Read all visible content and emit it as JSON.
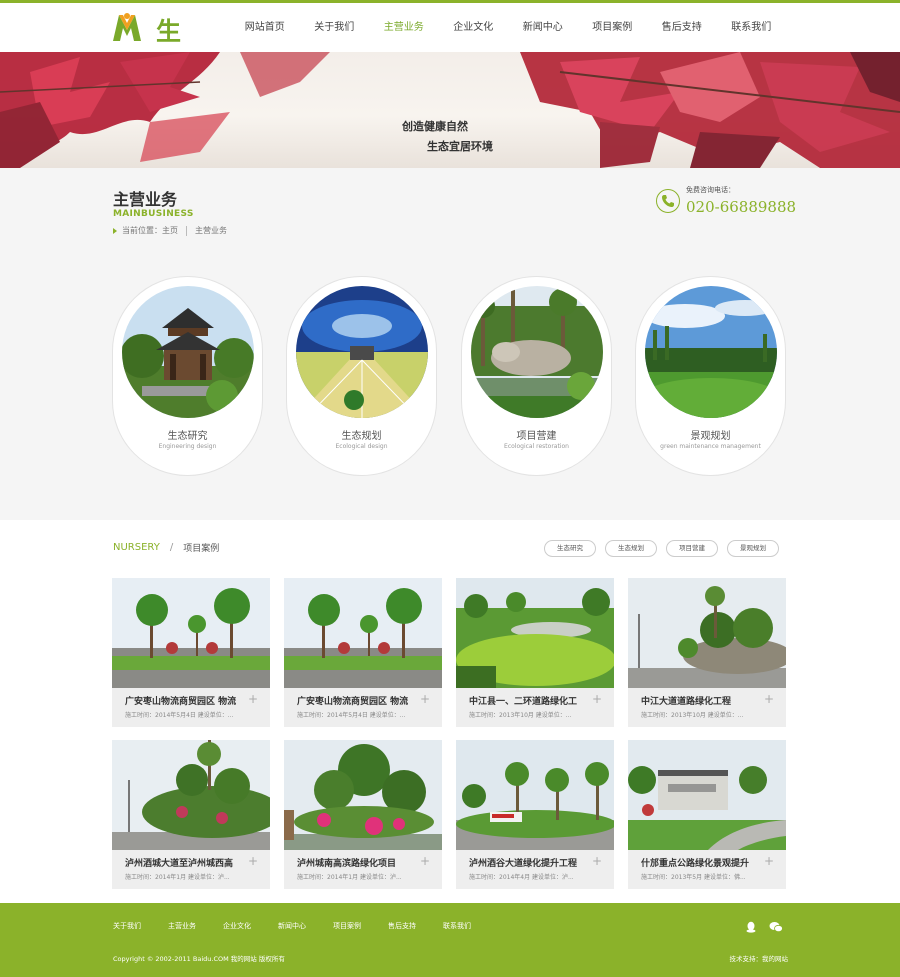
{
  "colors": {
    "brand": "#8bb22a",
    "footer": "#8bb22a",
    "pageBg": "#f5f5f5"
  },
  "header": {
    "logo_text": "生态",
    "nav": [
      {
        "label": "网站首页"
      },
      {
        "label": "关于我们"
      },
      {
        "label": "主营业务"
      },
      {
        "label": "企业文化"
      },
      {
        "label": "新闻中心"
      },
      {
        "label": "项目案例"
      },
      {
        "label": "售后支持"
      },
      {
        "label": "联系我们"
      }
    ],
    "active_nav": "主营业务"
  },
  "banner": {
    "line1": "创造健康自然",
    "line2": "生态宜居环境"
  },
  "section": {
    "title": "主营业务",
    "subtitle": "MAINBUSINESS",
    "breadcrumb_label": "当前位置：",
    "breadcrumb_home": "主页",
    "breadcrumb_current": "主营业务",
    "hotline_label": "免费咨询电话：",
    "hotline_number": "020-66889888"
  },
  "services": [
    {
      "name": "生态研究",
      "en": "Engineering design",
      "icon": "pavilion-photo"
    },
    {
      "name": "生态规划",
      "en": "Ecological design",
      "icon": "plaza-photo"
    },
    {
      "name": "项目营建",
      "en": "Ecological restoration",
      "icon": "garden-photo"
    },
    {
      "name": "景观规划",
      "en": "green maintenance management",
      "icon": "lawn-photo"
    }
  ],
  "projects": {
    "title_en": "NURSERY",
    "title_cn": "项目案例",
    "filters": [
      "生态研究",
      "生态规划",
      "项目营建",
      "景观规划"
    ],
    "items": [
      {
        "title": "广安枣山物流商贸园区 物流",
        "meta": "施工时间：2014年5月4日  建设单位：..."
      },
      {
        "title": "广安枣山物流商贸园区 物流",
        "meta": "施工时间：2014年5月4日  建设单位：..."
      },
      {
        "title": "中江县一、二环道路绿化工",
        "meta": "施工时间：2013年10月  建设单位：..."
      },
      {
        "title": "中江大道道路绿化工程",
        "meta": "施工时间：2013年10月  建设单位：..."
      },
      {
        "title": "泸州酒城大道至泸州城西高",
        "meta": "施工时间：2014年1月  建设单位：泸..."
      },
      {
        "title": "泸州城南高滨路绿化项目",
        "meta": "施工时间：2014年1月  建设单位：泸..."
      },
      {
        "title": "泸州酒谷大道绿化提升工程",
        "meta": "施工时间：2014年4月  建设单位：泸..."
      },
      {
        "title": "什邡重点公路绿化景观提升",
        "meta": "施工时间：2013年5月  建设单位：佛..."
      }
    ]
  },
  "footer": {
    "nav": [
      "关于我们",
      "主营业务",
      "企业文化",
      "新闻中心",
      "项目案例",
      "售后支持",
      "联系我们"
    ],
    "copyright": "Copyright © 2002-2011 Baidu.COM 我的网站 版权所有",
    "support": "技术支持：我的网站",
    "icons": [
      "qq-icon",
      "wechat-icon"
    ]
  }
}
